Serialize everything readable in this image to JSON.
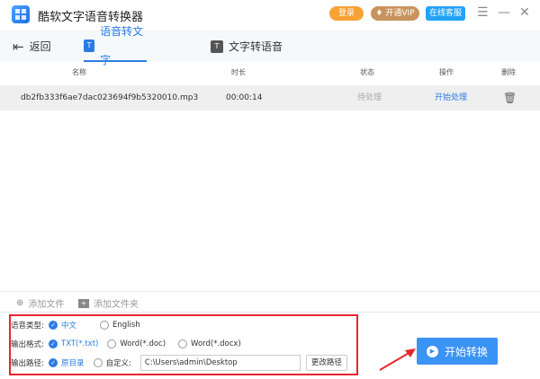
{
  "app": {
    "title": "酷软文字语音转换器",
    "login": "登录",
    "vip": "开通VIP",
    "service": "在线客服",
    "colors": {
      "login": "#f7a234",
      "vip": "#c8945c",
      "service": "#22a4f5",
      "accent": "#2c7be5"
    }
  },
  "tabs": {
    "back": "返回",
    "speech_to_text": "语音转文字",
    "text_to_speech": "文字转语音"
  },
  "table": {
    "headers": [
      "名称",
      "时长",
      "状态",
      "操作",
      "删除"
    ],
    "rows": [
      {
        "name": "db2fb333f6ae7dac023694f9b5320010.mp3",
        "duration": "00:00:14",
        "status": "待处理",
        "action": "开始处理"
      }
    ]
  },
  "add": {
    "file": "添加文件",
    "folder": "添加文件夹"
  },
  "options": {
    "voice_label": "语音类型:",
    "voice": [
      "中文",
      "English"
    ],
    "format_label": "输出格式:",
    "formats": [
      "TXT(*.txt)",
      "Word(*.doc)",
      "Word(*.docx)"
    ],
    "path_label": "输出路径:",
    "path_opts": [
      "原目录",
      "自定义:"
    ],
    "path_value": "C:\\Users\\admin\\Desktop",
    "change_path": "更改路径"
  },
  "start": "开始转换"
}
